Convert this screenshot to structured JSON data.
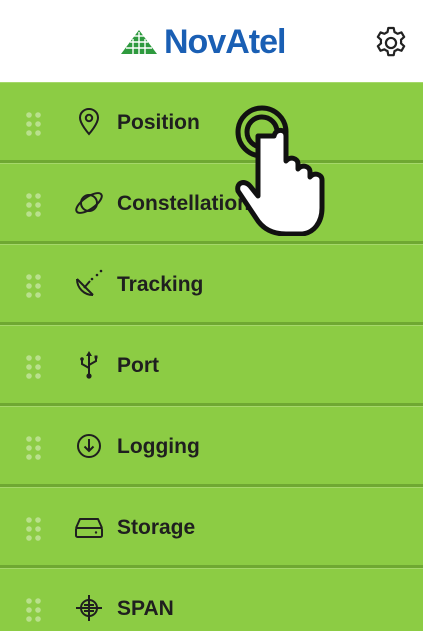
{
  "header": {
    "logo_text": "NovAtel",
    "settings_icon": "gear-icon"
  },
  "colors": {
    "menu_bg": "#8ccc44",
    "menu_border": "#6fa832",
    "brand_blue": "#1a5fb4",
    "brand_green": "#2e9a3e"
  },
  "menu": {
    "items": [
      {
        "label": "Position",
        "icon": "location-pin-icon"
      },
      {
        "label": "Constellation",
        "icon": "satellite-orbit-icon"
      },
      {
        "label": "Tracking",
        "icon": "satellite-dish-icon"
      },
      {
        "label": "Port",
        "icon": "usb-icon"
      },
      {
        "label": "Logging",
        "icon": "download-circle-icon"
      },
      {
        "label": "Storage",
        "icon": "hard-drive-icon"
      },
      {
        "label": "SPAN",
        "icon": "span-crosshair-icon"
      }
    ]
  },
  "overlay": {
    "gesture": "tap-hand-icon"
  }
}
